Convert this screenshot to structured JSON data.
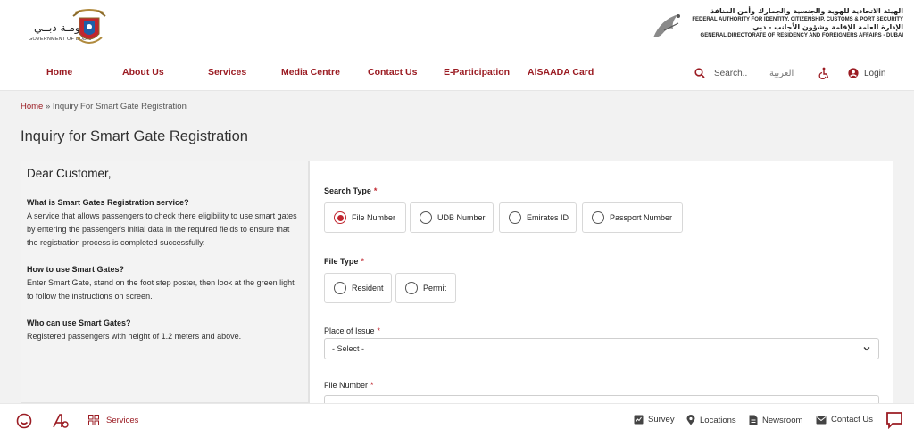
{
  "header": {
    "gov_name_ar": "حكـومـة دبــي",
    "gov_name_en": "GOVERNMENT OF DUBAI",
    "authority_ar_1": "الهيئة الاتحادية للهوية والجنسية والجمارك وأمن المنافذ",
    "authority_en_1": "FEDERAL AUTHORITY FOR IDENTITY, CITIZENSHIP, CUSTOMS & PORT SECURITY",
    "authority_ar_2": "الإدارة العامة للإقامة وشؤون الأجانب - دبي",
    "authority_en_2": "GENERAL DIRECTORATE OF RESIDENCY AND FOREIGNERS AFFAIRS - DUBAI"
  },
  "nav": {
    "items": [
      "Home",
      "About Us",
      "Services",
      "Media Centre",
      "Contact Us",
      "E-Participation",
      "AlSAADA Card"
    ],
    "search_placeholder": "Search..",
    "arabic_label": "العربية",
    "login_label": "Login",
    "accessibility_icon": "wheelchair-icon"
  },
  "breadcrumb": {
    "home": "Home",
    "separator": " » ",
    "current": "Inquiry For Smart Gate Registration"
  },
  "page_title": "Inquiry for Smart Gate Registration",
  "info": {
    "greeting": "Dear Customer,",
    "sections": [
      {
        "title": "What is Smart Gates Registration service?",
        "text": "A service that allows passengers to check there eligibility to use smart gates by entering the passenger's initial data in the required fields to ensure that the registration process is completed successfully."
      },
      {
        "title": "How to use Smart Gates?",
        "text": "Enter Smart Gate, stand on the foot step poster, then look at the green light to follow the instructions on screen."
      },
      {
        "title": "Who can use Smart Gates?",
        "text": "Registered passengers with height of 1.2 meters and above."
      }
    ]
  },
  "form": {
    "search_type_label": "Search Type",
    "required_mark": "*",
    "search_type_options": [
      "File Number",
      "UDB Number",
      "Emirates ID",
      "Passport Number"
    ],
    "search_type_selected": "File Number",
    "file_type_label": "File Type",
    "file_type_options": [
      "Resident",
      "Permit"
    ],
    "place_of_issue_label": "Place of Issue",
    "place_of_issue_value": "- Select -",
    "file_number_label": "File Number"
  },
  "bottom_bar": {
    "services_label": "Services",
    "survey_label": "Survey",
    "locations_label": "Locations",
    "newsroom_label": "Newsroom",
    "contact_label": "Contact Us"
  },
  "colors": {
    "brand_red": "#9b1c23",
    "accent_red": "#c0262f"
  }
}
